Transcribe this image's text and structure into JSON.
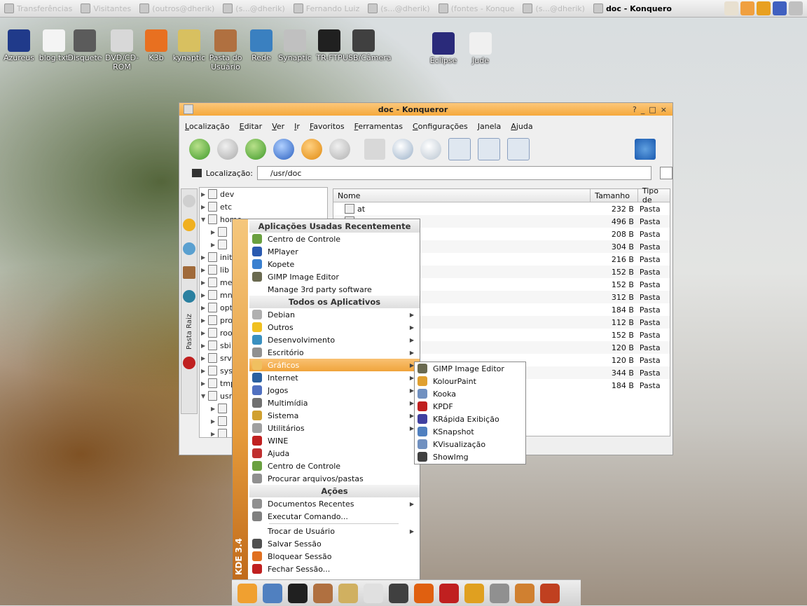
{
  "taskbar": {
    "tasks": [
      {
        "label": "Transferências",
        "active": false
      },
      {
        "label": "Visitantes",
        "active": false
      },
      {
        "label": "(outros@dherik)",
        "active": false
      },
      {
        "label": "(s...@dherik)",
        "active": false
      },
      {
        "label": "Fernando Luiz",
        "active": false
      },
      {
        "label": "(s...@dherik)",
        "active": false
      },
      {
        "label": "(fontes - Konque",
        "active": false
      },
      {
        "label": "(s...@dherik)",
        "active": false
      },
      {
        "label": "doc - Konquero",
        "active": true
      }
    ],
    "tray_colors": [
      "#e8e0d0",
      "#f0a040",
      "#e8a020",
      "#4060c0",
      "#c0c0c0"
    ]
  },
  "desktop_icons": [
    {
      "label": "Azureus",
      "color": "#203a8a"
    },
    {
      "label": "blog.txt",
      "color": "#f4f4f4"
    },
    {
      "label": "Disquete",
      "color": "#5b5b5b"
    },
    {
      "label": "DVD/CD-ROM",
      "color": "#d8d8d8"
    },
    {
      "label": "K3b",
      "color": "#e87020"
    },
    {
      "label": "kynaptic",
      "color": "#d8c060"
    },
    {
      "label": "Pasta do Usuário",
      "color": "#b07040"
    },
    {
      "label": "Rede",
      "color": "#3a80c0"
    },
    {
      "label": "Synaptic",
      "color": "#c0c0c0"
    },
    {
      "label": "TR-FTP",
      "color": "#202020"
    },
    {
      "label": "USB/Câmera",
      "color": "#404040"
    },
    {
      "label": "Eclipse",
      "color": "#2a2a7a"
    },
    {
      "label": "Jude",
      "color": "#f0f0f0"
    }
  ],
  "konqueror": {
    "title": "doc - Konqueror",
    "title_buttons": [
      "?",
      "_",
      "□",
      "×"
    ],
    "menu": [
      "Localização",
      "Editar",
      "Ver",
      "Ir",
      "Favoritos",
      "Ferramentas",
      "Configurações",
      "Janela",
      "Ajuda"
    ],
    "location_label": "Localização:",
    "location_value": "/usr/doc",
    "sidebar_label": "Pasta Raiz",
    "tree": [
      {
        "name": "dev",
        "expanded": false,
        "indent": 0
      },
      {
        "name": "etc",
        "expanded": false,
        "indent": 0
      },
      {
        "name": "home",
        "expanded": true,
        "indent": 0
      },
      {
        "name": "",
        "expanded": false,
        "indent": 1
      },
      {
        "name": "",
        "expanded": false,
        "indent": 1
      },
      {
        "name": "init",
        "expanded": false,
        "indent": 0
      },
      {
        "name": "lib",
        "expanded": false,
        "indent": 0
      },
      {
        "name": "me",
        "expanded": false,
        "indent": 0
      },
      {
        "name": "mn",
        "expanded": false,
        "indent": 0
      },
      {
        "name": "opt",
        "expanded": false,
        "indent": 0
      },
      {
        "name": "pro",
        "expanded": false,
        "indent": 0
      },
      {
        "name": "roo",
        "expanded": false,
        "indent": 0
      },
      {
        "name": "sbi",
        "expanded": false,
        "indent": 0
      },
      {
        "name": "srv",
        "expanded": false,
        "indent": 0
      },
      {
        "name": "sys",
        "expanded": false,
        "indent": 0
      },
      {
        "name": "tmp",
        "expanded": false,
        "indent": 0
      },
      {
        "name": "usr",
        "expanded": true,
        "indent": 0
      },
      {
        "name": "",
        "expanded": false,
        "indent": 1
      },
      {
        "name": "",
        "expanded": false,
        "indent": 1
      },
      {
        "name": "",
        "expanded": false,
        "indent": 1
      }
    ],
    "list_headers": [
      "Nome",
      "Tamanho",
      "Tipo de"
    ],
    "list_rows": [
      {
        "name": "at",
        "size": "232 B",
        "type": "Pasta"
      },
      {
        "name": "",
        "size": "496 B",
        "type": "Pasta"
      },
      {
        "name": "",
        "size": "208 B",
        "type": "Pasta"
      },
      {
        "name": "",
        "size": "304 B",
        "type": "Pasta"
      },
      {
        "name": "",
        "size": "216 B",
        "type": "Pasta"
      },
      {
        "name": "",
        "size": "152 B",
        "type": "Pasta"
      },
      {
        "name": "",
        "size": "152 B",
        "type": "Pasta"
      },
      {
        "name": "",
        "size": "312 B",
        "type": "Pasta"
      },
      {
        "name": "",
        "size": "184 B",
        "type": "Pasta"
      },
      {
        "name": "",
        "size": "112 B",
        "type": "Pasta"
      },
      {
        "name": "",
        "size": "152 B",
        "type": "Pasta"
      },
      {
        "name": "",
        "size": "120 B",
        "type": "Pasta"
      },
      {
        "name": "",
        "size": "120 B",
        "type": "Pasta"
      },
      {
        "name": "",
        "size": "344 B",
        "type": "Pasta"
      },
      {
        "name": "",
        "size": "184 B",
        "type": "Pasta"
      }
    ]
  },
  "kde_menu": {
    "side_label": "KDE 3.4",
    "sections": [
      {
        "header": "Aplicações Usadas Recentemente",
        "items": [
          {
            "label": "Centro de Controle",
            "icon": "#6aa040",
            "sub": false
          },
          {
            "label": "MPlayer",
            "icon": "#2a5ab0",
            "sub": false
          },
          {
            "label": "Kopete",
            "icon": "#3a80d0",
            "sub": false
          },
          {
            "label": "GIMP Image Editor",
            "icon": "#6a6a50",
            "sub": false
          },
          {
            "label": "Manage 3rd party software",
            "icon": "#ffffff",
            "sub": false
          }
        ]
      },
      {
        "header": "Todos os Aplicativos",
        "items": [
          {
            "label": "Debian",
            "icon": "#b0b0b0",
            "sub": true
          },
          {
            "label": "Outros",
            "icon": "#f0c020",
            "sub": true
          },
          {
            "label": "Desenvolvimento",
            "icon": "#3a90c0",
            "sub": true
          },
          {
            "label": "Escritório",
            "icon": "#909090",
            "sub": true
          },
          {
            "label": "Gráficos",
            "icon": "#f0c060",
            "sub": true,
            "highlight": true
          },
          {
            "label": "Internet",
            "icon": "#2a60a0",
            "sub": true
          },
          {
            "label": "Jogos",
            "icon": "#5070c0",
            "sub": true
          },
          {
            "label": "Multimídia",
            "icon": "#707070",
            "sub": true
          },
          {
            "label": "Sistema",
            "icon": "#d0a030",
            "sub": true
          },
          {
            "label": "Utilitários",
            "icon": "#a0a0a0",
            "sub": true
          },
          {
            "label": "WINE",
            "icon": "#c02020",
            "sub": false
          },
          {
            "label": "Ajuda",
            "icon": "#c03030",
            "sub": false
          },
          {
            "label": "Centro de Controle",
            "icon": "#6aa040",
            "sub": false
          },
          {
            "label": "Procurar arquivos/pastas",
            "icon": "#909090",
            "sub": false
          }
        ]
      },
      {
        "header": "Ações",
        "items": [
          {
            "label": "Documentos Recentes",
            "icon": "#909090",
            "sub": true
          },
          {
            "label": "Executar Comando...",
            "icon": "#808080",
            "sub": false
          },
          {
            "sep": true
          },
          {
            "label": "Trocar de Usuário",
            "icon": "",
            "sub": true
          },
          {
            "label": "Salvar Sessão",
            "icon": "#505050",
            "sub": false
          },
          {
            "label": "Bloquear Sessão",
            "icon": "#e07020",
            "sub": false
          },
          {
            "label": "Fechar Sessão...",
            "icon": "#c02020",
            "sub": false
          }
        ]
      }
    ]
  },
  "graphics_submenu": [
    {
      "label": "GIMP Image Editor",
      "icon": "#6a6a50"
    },
    {
      "label": "KolourPaint",
      "icon": "#e0a030"
    },
    {
      "label": "Kooka",
      "icon": "#7090c0"
    },
    {
      "label": "KPDF",
      "icon": "#c02020"
    },
    {
      "label": "KRápida Exibição",
      "icon": "#4040a0"
    },
    {
      "label": "KSnapshot",
      "icon": "#5080c0"
    },
    {
      "label": "KVisualização",
      "icon": "#7090c0"
    },
    {
      "label": "ShowImg",
      "icon": "#404040"
    }
  ],
  "panel_icons": [
    "#f0a030",
    "#5080c0",
    "#202020",
    "#b07040",
    "#d0b060",
    "#e0e0e0",
    "#404040",
    "#e06010",
    "#c02020",
    "#e0a020",
    "#909090",
    "#d08030",
    "#c04020"
  ]
}
